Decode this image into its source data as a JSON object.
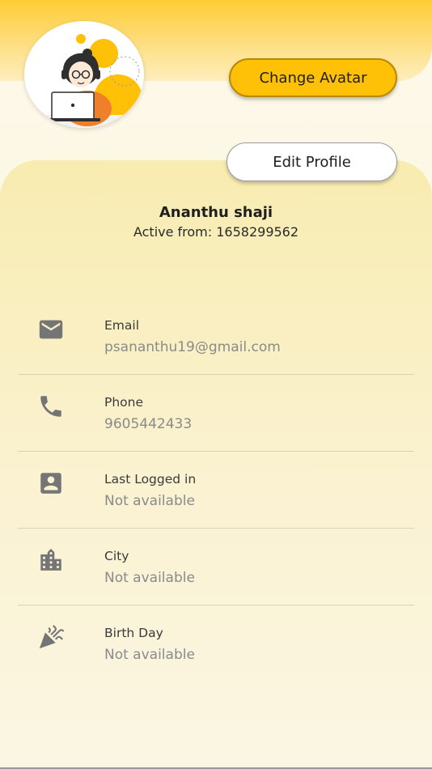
{
  "header": {
    "change_avatar_label": "Change Avatar",
    "edit_profile_label": "Edit Profile",
    "accent_color": "#ffc107"
  },
  "profile": {
    "name": "Ananthu shaji",
    "active_from": "Active from: 1658299562"
  },
  "details": [
    {
      "icon": "email-icon",
      "label": "Email",
      "value": "psananthu19@gmail.com"
    },
    {
      "icon": "phone-icon",
      "label": "Phone",
      "value": "9605442433"
    },
    {
      "icon": "contact-card-icon",
      "label": "Last Logged in",
      "value": "Not available"
    },
    {
      "icon": "city-building-icon",
      "label": "City",
      "value": "Not available"
    },
    {
      "icon": "party-popper-icon",
      "label": "Birth Day",
      "value": "Not available"
    }
  ]
}
